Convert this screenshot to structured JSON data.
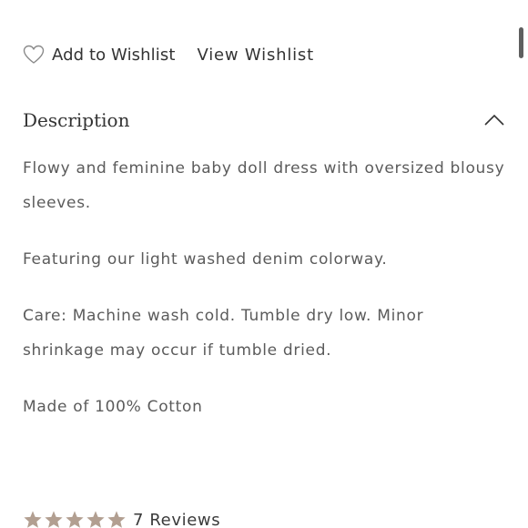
{
  "wishlist": {
    "add_label": "Add to Wishlist",
    "view_label": "View Wishlist",
    "heart_icon": "heart-outline-icon"
  },
  "description": {
    "title": "Description",
    "toggle_icon": "chevron-up-icon",
    "paragraphs": [
      "Flowy and feminine baby doll dress with oversized blousy sleeves.",
      "Featuring our light washed denim colorway.",
      "Care: Machine wash cold. Tumble dry low. Minor shrinkage may occur if tumble dried.",
      "Made of 100% Cotton"
    ]
  },
  "reviews": {
    "rating": 5,
    "max_rating": 5,
    "count_label": "7 Reviews",
    "star_color": "#b29f91"
  },
  "colors": {
    "text": "#5b5b5b",
    "heading": "#333333",
    "background": "#ffffff"
  }
}
